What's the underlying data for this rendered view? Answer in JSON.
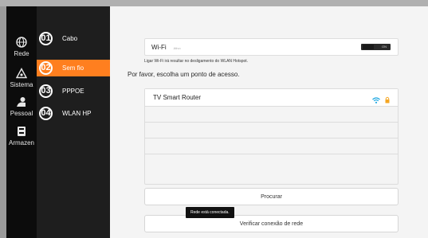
{
  "nav_rail": [
    {
      "label": "Rede",
      "icon": "globe-icon"
    },
    {
      "label": "Sistema",
      "icon": "triangle-icon"
    },
    {
      "label": "Pessoal",
      "icon": "person-icon"
    },
    {
      "label": "Armazen",
      "icon": "storage-icon"
    }
  ],
  "sub_menu": [
    {
      "num": "01",
      "label": "Cabo",
      "active": false
    },
    {
      "num": "02",
      "label": "Sem fio",
      "active": true
    },
    {
      "num": "03",
      "label": "PPPOE",
      "active": false
    },
    {
      "num": "04",
      "label": "WLAN HP",
      "active": false
    }
  ],
  "wifi": {
    "label": "Wi-Fi",
    "ghost": "Ativo",
    "toggle_label": "ON",
    "toggle_on": true
  },
  "hint": "Ligar Wi-Fi irá resultar no desligamento do WLAN Hotspot.",
  "choose_title": "Por favor, escolha um ponto de acesso.",
  "access_points": [
    {
      "name": "TV Smart Router",
      "wifi_icon": "wifi-icon",
      "lock_icon": "lock-icon"
    },
    {
      "name": ""
    },
    {
      "name": ""
    },
    {
      "name": ""
    },
    {
      "name": ""
    }
  ],
  "buttons": {
    "search": "Procurar",
    "check": "Verificar conexão de rede"
  },
  "toast": "Rede está conectada.",
  "colors": {
    "accent": "#ff7f1f",
    "wifi_icon": "#1ea7e1",
    "lock_icon": "#f5a623"
  }
}
